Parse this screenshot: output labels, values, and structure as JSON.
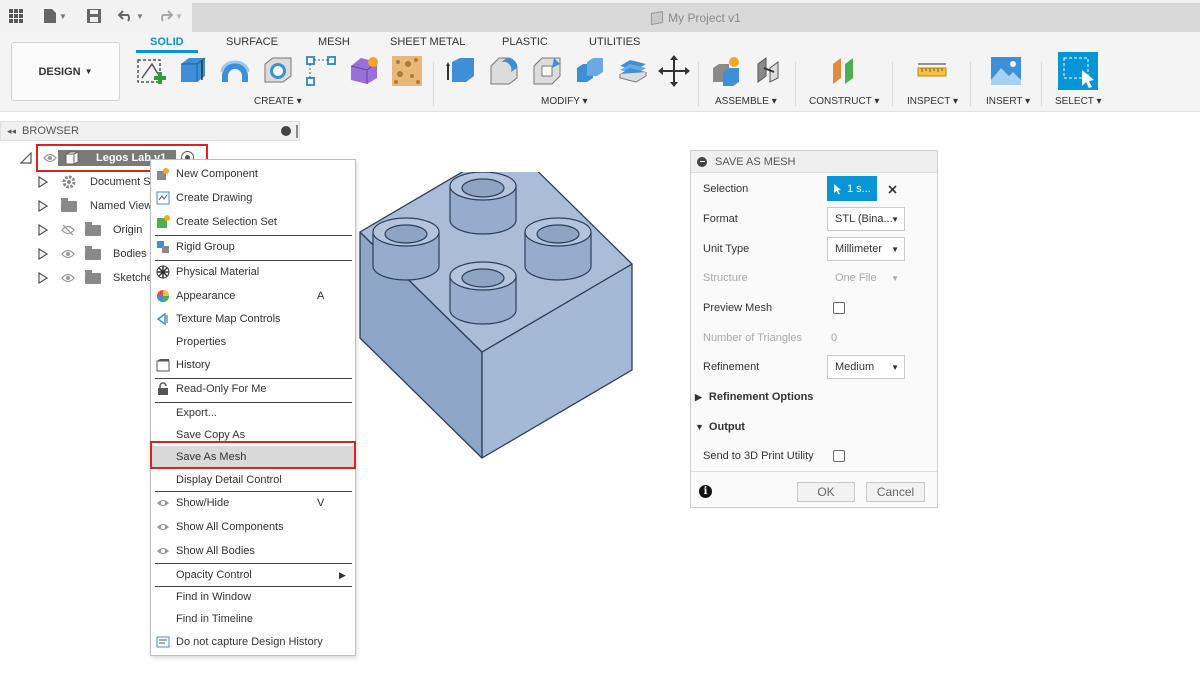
{
  "titlebar": {
    "project_title": "My Project v1"
  },
  "ribbon": {
    "workspace_label": "DESIGN",
    "tabs": [
      "SOLID",
      "SURFACE",
      "MESH",
      "SHEET METAL",
      "PLASTIC",
      "UTILITIES"
    ],
    "groups": [
      "CREATE",
      "MODIFY",
      "ASSEMBLE",
      "CONSTRUCT",
      "INSPECT",
      "INSERT",
      "SELECT"
    ]
  },
  "browser": {
    "title": "BROWSER",
    "root": "Legos Lab v1",
    "items": [
      "Document Se",
      "Named View",
      "Origin",
      "Bodies",
      "Sketche"
    ]
  },
  "context_menu": {
    "items": [
      {
        "label": "New Component"
      },
      {
        "label": "Create Drawing"
      },
      {
        "label": "Create Selection Set"
      },
      {
        "label": "Rigid Group"
      },
      {
        "label": "Physical Material"
      },
      {
        "label": "Appearance",
        "shortcut": "A"
      },
      {
        "label": "Texture Map Controls"
      },
      {
        "label": "Properties"
      },
      {
        "label": "History"
      },
      {
        "label": "Read-Only For Me"
      },
      {
        "label": "Export..."
      },
      {
        "label": "Save Copy As"
      },
      {
        "label": "Save As Mesh"
      },
      {
        "label": "Display Detail Control"
      },
      {
        "label": "Show/Hide",
        "shortcut": "V"
      },
      {
        "label": "Show All Components"
      },
      {
        "label": "Show All Bodies"
      },
      {
        "label": "Opacity Control"
      },
      {
        "label": "Find in Window"
      },
      {
        "label": "Find in Timeline"
      },
      {
        "label": "Do not capture Design History"
      }
    ]
  },
  "dialog": {
    "title": "SAVE AS MESH",
    "selection_label": "Selection",
    "selection_value": "1 s...",
    "format_label": "Format",
    "format_value": "STL (Bina...",
    "unit_label": "Unit Type",
    "unit_value": "Millimeter",
    "structure_label": "Structure",
    "structure_value": "One File",
    "preview_label": "Preview Mesh",
    "triangles_label": "Number of Triangles",
    "triangles_value": "0",
    "refinement_label": "Refinement",
    "refinement_value": "Medium",
    "refinement_options_label": "Refinement Options",
    "output_label": "Output",
    "send_label": "Send to 3D Print Utility",
    "ok_label": "OK",
    "cancel_label": "Cancel"
  },
  "colors": {
    "accent": "#0696d7",
    "highlight_border": "#dd2222",
    "brick": "#a9bdd8"
  }
}
